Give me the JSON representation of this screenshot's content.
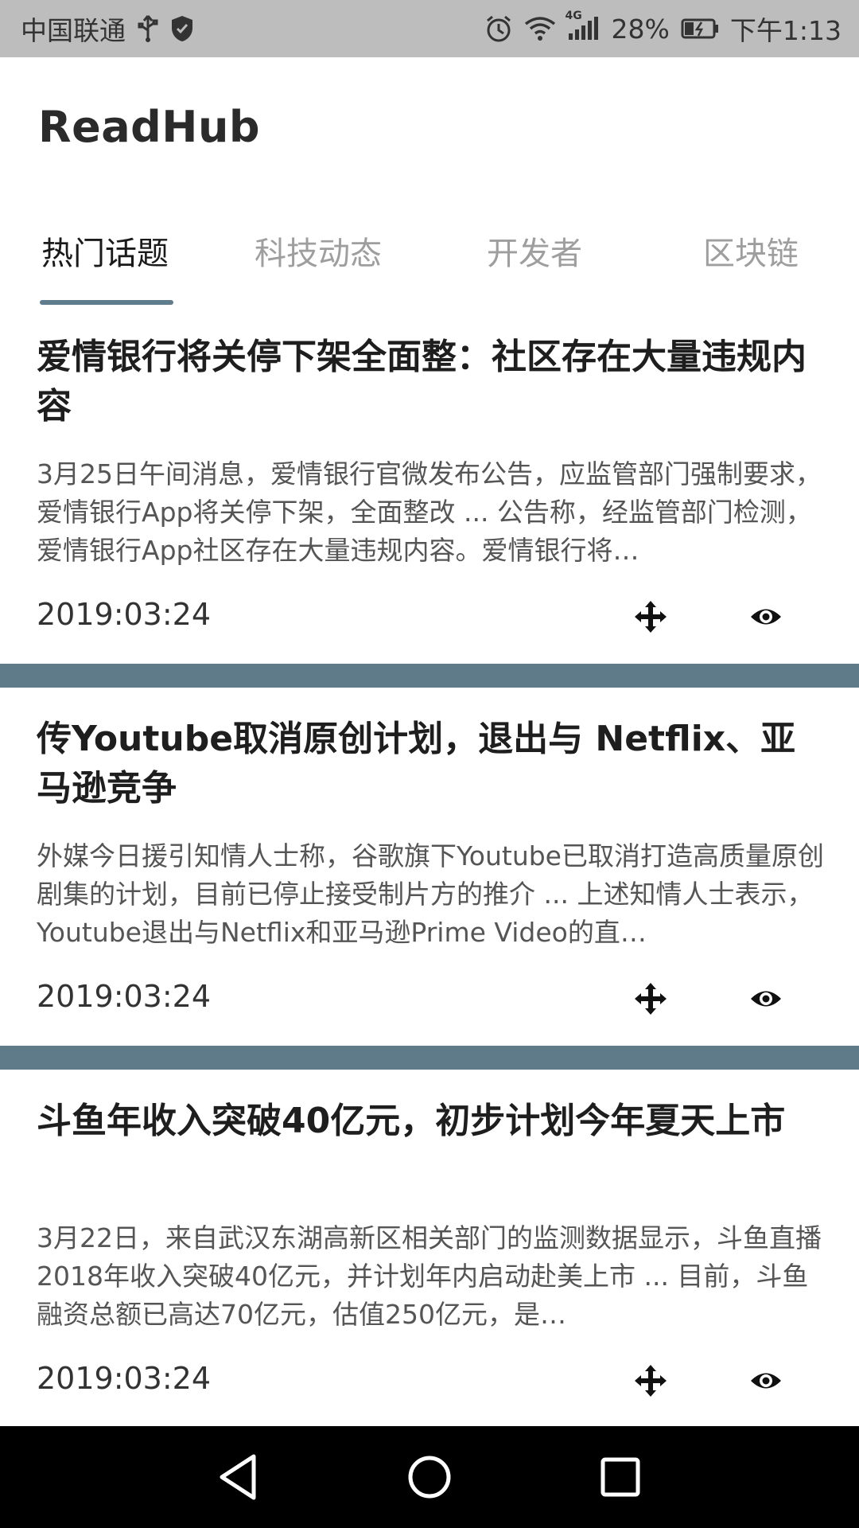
{
  "status_bar": {
    "carrier": "中国联通",
    "network": "4G",
    "battery": "28%",
    "time": "下午1:13"
  },
  "app": {
    "title": "ReadHub"
  },
  "tabs": [
    {
      "label": "热门话题",
      "active": true
    },
    {
      "label": "科技动态",
      "active": false
    },
    {
      "label": "开发者",
      "active": false
    },
    {
      "label": "区块链",
      "active": false
    }
  ],
  "articles": [
    {
      "title": "爱情银行将关停下架全面整：社区存在大量违规内容",
      "summary": "3月25日午间消息，爱情银行官微发布公告，应监管部门强制要求，爱情银行App将关停下架，全面整改 ... 公告称，经监管部门检测，爱情银行App社区存在大量违规内容。爱情银行将…",
      "date": "2019:03:24"
    },
    {
      "title": "传Youtube取消原创计划，退出与 Netflix、亚马逊竞争",
      "summary": "外媒今日援引知情人士称，谷歌旗下Youtube已取消打造高质量原创剧集的计划，目前已停止接受制片方的推介 ... 上述知情人士表示，Youtube退出与Netflix和亚马逊Prime Video的直…",
      "date": "2019:03:24"
    },
    {
      "title": "斗鱼年收入突破40亿元，初步计划今年夏天上市",
      "summary": "3月22日，来自武汉东湖高新区相关部门的监测数据显示，斗鱼直播2018年收入突破40亿元，并计划年内启动赴美上市 ... 目前，斗鱼融资总额已高达70亿元，估值250亿元，是…",
      "date": "2019:03:24"
    }
  ],
  "colors": {
    "accent": "#5f7d8c",
    "divider": "#5f7b8a",
    "status_bar": "#bdbdbd",
    "nav_bar": "#000000"
  },
  "icons": {
    "article_action_1": "move-icon",
    "article_action_2": "eye-icon"
  }
}
